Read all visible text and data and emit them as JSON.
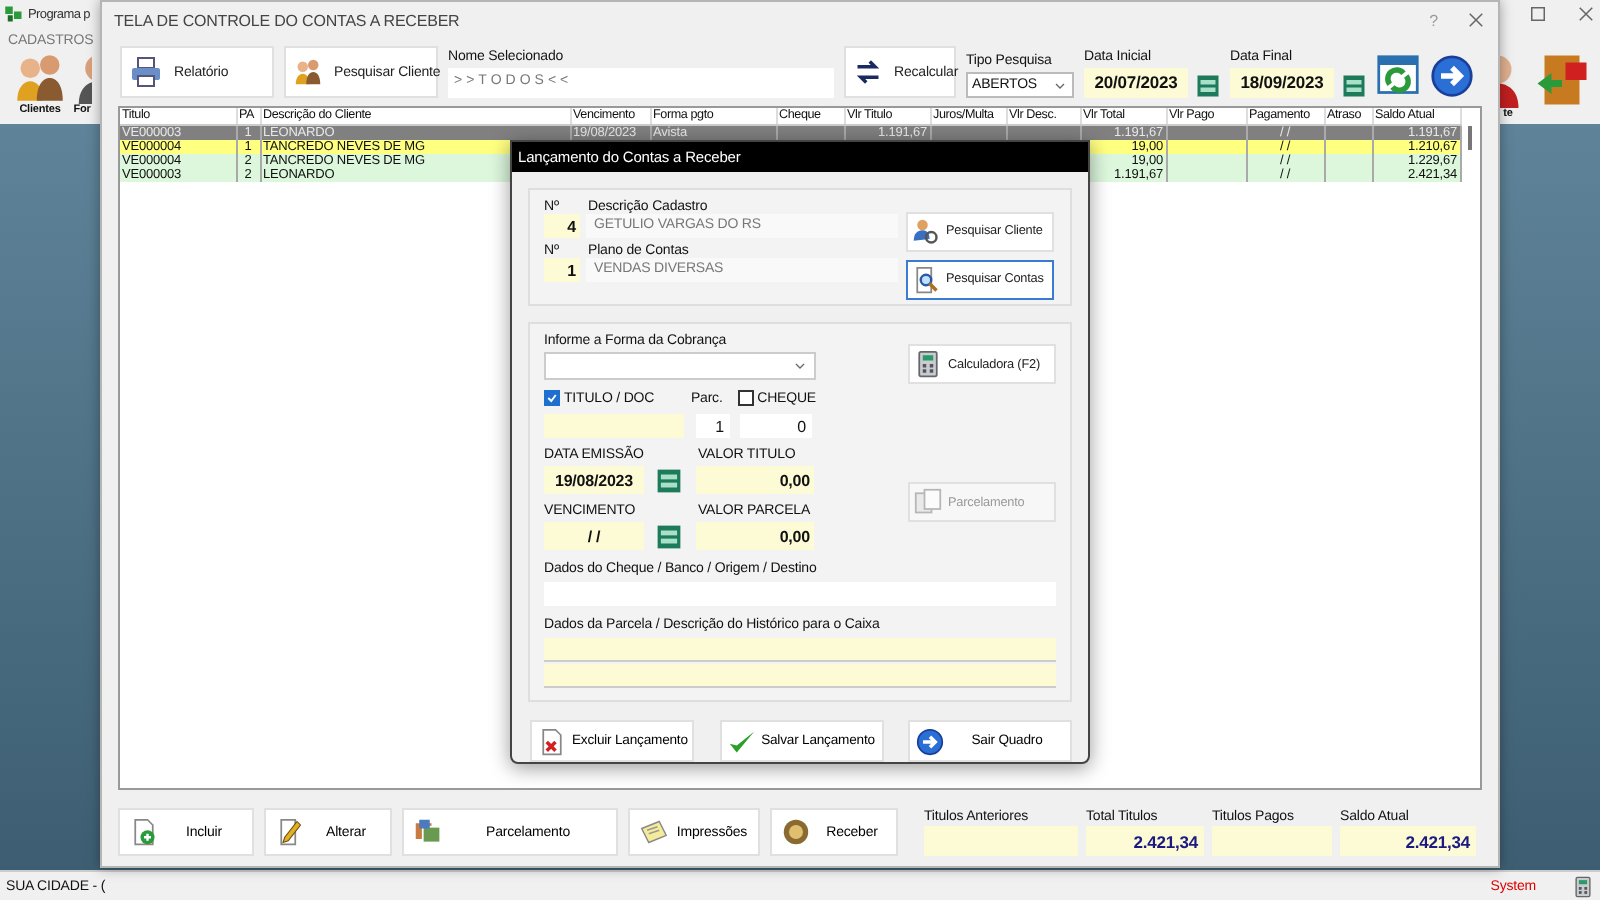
{
  "app": {
    "title": "Programa p",
    "menu": [
      "CADASTROS"
    ],
    "toolbar": [
      {
        "label": "Clientes"
      },
      {
        "label": "For"
      }
    ],
    "right_toolbar": [
      {
        "label": "te"
      }
    ],
    "status_bar": {
      "left": "SUA CIDADE - (",
      "right": "System"
    }
  },
  "window": {
    "title": "TELA DE CONTROLE DO CONTAS A RECEBER",
    "help": "?",
    "toolbar": {
      "report_button": "Relatório",
      "search_client_button": "Pesquisar Cliente",
      "selected_name": {
        "label": "Nome Selecionado",
        "value": ">>TODOS<<"
      },
      "recalc_button": "Recalcular",
      "search_type": {
        "label": "Tipo  Pesquisa",
        "value": "ABERTOS"
      },
      "start_date": {
        "label": "Data Inicial",
        "value": "20/07/2023"
      },
      "end_date": {
        "label": "Data Final",
        "value": "18/09/2023"
      }
    },
    "table": {
      "columns": [
        "Titulo",
        "PA",
        "Descrição do Cliente",
        "Vencimento",
        "Forma pgto",
        "Cheque",
        "Vlr Titulo",
        "Juros/Multa",
        "Vlr Desc.",
        "Vlr Total",
        "Vlr Pago",
        "Pagamento",
        "Atraso",
        "Saldo Atual"
      ],
      "rows": [
        {
          "color": "#808080",
          "titulo": "VE000003",
          "pa": "1",
          "cliente": "LEONARDO",
          "vencimento": "19/08/2023",
          "forma_pgto": "Avista",
          "vlr_titulo": "1.191,67",
          "vlr_total": "1.191,67",
          "pagamento": "/ /",
          "saldo_atual": "1.191,67"
        },
        {
          "color": "#ffff80",
          "titulo": "VE000004",
          "pa": "1",
          "cliente": "TANCREDO NEVES DE MG",
          "vlr_total": "19,00",
          "pagamento": "/ /",
          "saldo_atual": "1.210,67"
        },
        {
          "color": "#dcf7dc",
          "titulo": "VE000004",
          "pa": "2",
          "cliente": "TANCREDO NEVES DE MG",
          "vlr_total": "19,00",
          "pagamento": "/ /",
          "saldo_atual": "1.229,67"
        },
        {
          "color": "#dcf7dc",
          "titulo": "VE000003",
          "pa": "2",
          "cliente": "LEONARDO",
          "vlr_total": "1.191,67",
          "pagamento": "/ /",
          "saldo_atual": "2.421,34"
        }
      ]
    },
    "buttons": [
      "Incluir",
      "Alterar",
      "Parcelamento",
      "Impressões",
      "Receber"
    ],
    "totals": [
      {
        "label": "Titulos Anteriores"
      },
      {
        "label": "Total Titulos",
        "value": "2.421,34"
      },
      {
        "label": "Titulos Pagos"
      },
      {
        "label": "Saldo Atual",
        "value": "2.421,34"
      }
    ]
  },
  "dialog": {
    "title": "Lançamento do Contas a Receber",
    "cadastro": {
      "number_label": "Nº",
      "label": "Descrição Cadastro",
      "number": "4",
      "value": "GETULIO VARGAS DO RS"
    },
    "plano": {
      "number_label": "Nº",
      "label": "Plano de Contas",
      "number": "1",
      "value": "VENDAS DIVERSAS"
    },
    "search_client_button": {
      "label": "Pesquisar Cliente",
      "focused": false
    },
    "search_accounts_button": {
      "label": "Pesquisar Contas",
      "focused": true
    },
    "calculator_button": {
      "label": "Calculadora (F2)",
      "disabled": false
    },
    "installment_button": {
      "label": "Parcelamento",
      "disabled": true
    },
    "charge_form": {
      "label": "Informe a Forma da Cobrança"
    },
    "titulo_doc": {
      "label": "TITULO / DOC",
      "checked": true
    },
    "parc": {
      "label": "Parc.",
      "value": "1"
    },
    "cheque": {
      "label": "CHEQUE",
      "checked": false,
      "value": "0"
    },
    "issue_date": {
      "label": "DATA EMISSÃO",
      "value": "19/08/2023"
    },
    "title_value": {
      "label": "VALOR TITULO",
      "value": "0,00"
    },
    "due_date": {
      "label": "VENCIMENTO",
      "value": "/ /"
    },
    "installment_value": {
      "label": "VALOR PARCELA",
      "value": "0,00"
    },
    "cheque_data": {
      "label": "Dados do Cheque / Banco / Origem / Destino"
    },
    "installment_data": {
      "label": "Dados da Parcela / Descrição do Histórico para o Caixa"
    },
    "buttons": [
      "Excluir Lançamento",
      "Salvar Lançamento",
      "Sair Quadro"
    ]
  }
}
